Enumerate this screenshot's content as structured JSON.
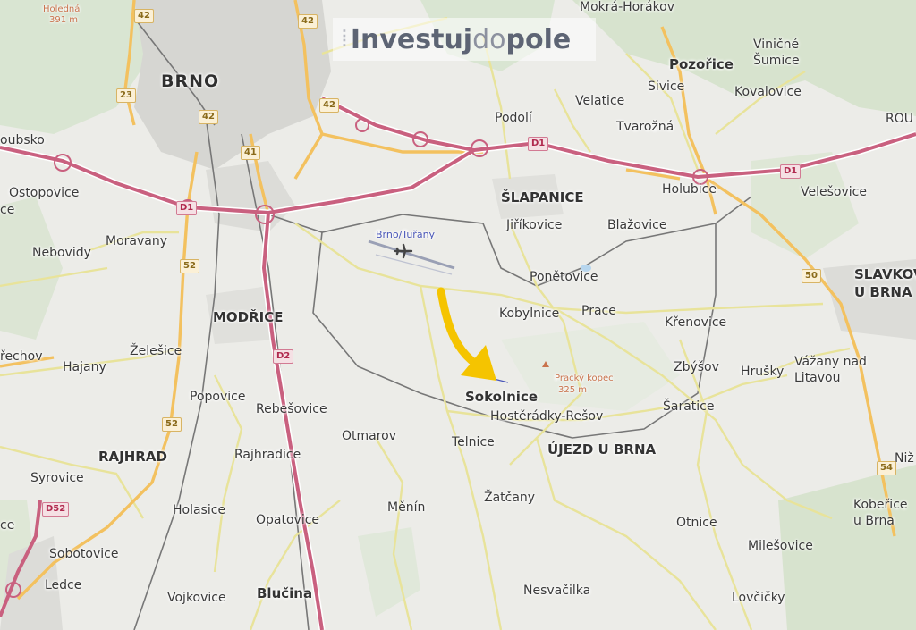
{
  "logo": {
    "part1": "Investuj",
    "part2": "do",
    "part3": "pole"
  },
  "colors": {
    "motorway": "#c9607f",
    "main_road": "#f3c15f",
    "secondary_road": "#e8e39a",
    "rail": "#6d6d6d",
    "forest": "#cfe0c6",
    "urban": "#d6d6d2",
    "arrow": "#f5c400"
  },
  "labels": {
    "brno": "BRNO",
    "modrice": "MODŘICE",
    "slapanice": "ŠLAPANICE",
    "rajhrad": "RAJHRAD",
    "ujezd": "ÚJEZD U BRNA",
    "slavkov1": "SLAVKOV",
    "slavkov2": "U BRNA",
    "pozorice": "Pozořice",
    "sokolnice": "Sokolnice",
    "blucina": "Blučina",
    "mokra": "Mokrá-Horákov",
    "vinicne1": "Viničné",
    "vinicne2": "Šumice",
    "sivice": "Sivice",
    "kovalovice": "Kovalovice",
    "velatice": "Velatice",
    "podoli": "Podolí",
    "tvarozna": "Tvarožná",
    "rou": "ROU",
    "holubice": "Holubice",
    "velesovice": "Velešovice",
    "ostopovice": "Ostopovice",
    "oubsko": "oubsko",
    "ce": "ce",
    "moravany": "Moravany",
    "nebovidy": "Nebovidy",
    "jirikovice": "Jiříkovice",
    "blazovice": "Blažovice",
    "ponetovice": "Ponětovice",
    "kobylnice": "Kobylnice",
    "prace": "Prace",
    "krenovice": "Křenovice",
    "zelesice": "Želešice",
    "hajany": "Hajany",
    "rechov": "řechov",
    "zbysov": "Zbýšov",
    "hrusky": "Hrušky",
    "vazany1": "Vážany nad",
    "vazany2": "Litavou",
    "popovice": "Popovice",
    "rebesovice": "Rebešovice",
    "hosteradky": "Hostěrádky-Rešov",
    "saratice": "Šaratice",
    "otmarov": "Otmarov",
    "telnice": "Telnice",
    "rajhradice": "Rajhradice",
    "syrovice": "Syrovice",
    "zatcany": "Žatčany",
    "holasice": "Holasice",
    "menin": "Měnín",
    "otnice": "Otnice",
    "opatovice": "Opatovice",
    "kobërice1": "Kobeřice",
    "kobërice2": "u Brna",
    "milesovice": "Milešovice",
    "sobotovice": "Sobotovice",
    "ledce": "Ledce",
    "nesvacilka": "Nesvačilka",
    "vojkovice": "Vojkovice",
    "lovcicky": "Lovčičky",
    "ce2": "ce",
    "niz": "Niž",
    "airport": "Brno/Tuřany",
    "peak1": "Pracký kopec",
    "peak2": "325 m",
    "holedna1": "Holedná",
    "holedna2": "391 m"
  },
  "shields": {
    "r42a": "42",
    "r42b": "42",
    "r42c": "42",
    "r42d": "42",
    "r23": "23",
    "r41": "41",
    "r52a": "52",
    "r52b": "52",
    "r50": "50",
    "r54": "54",
    "r52c": "D52",
    "d1a": "D1",
    "d1b": "D1",
    "d1c": "D1",
    "d2": "D2"
  }
}
